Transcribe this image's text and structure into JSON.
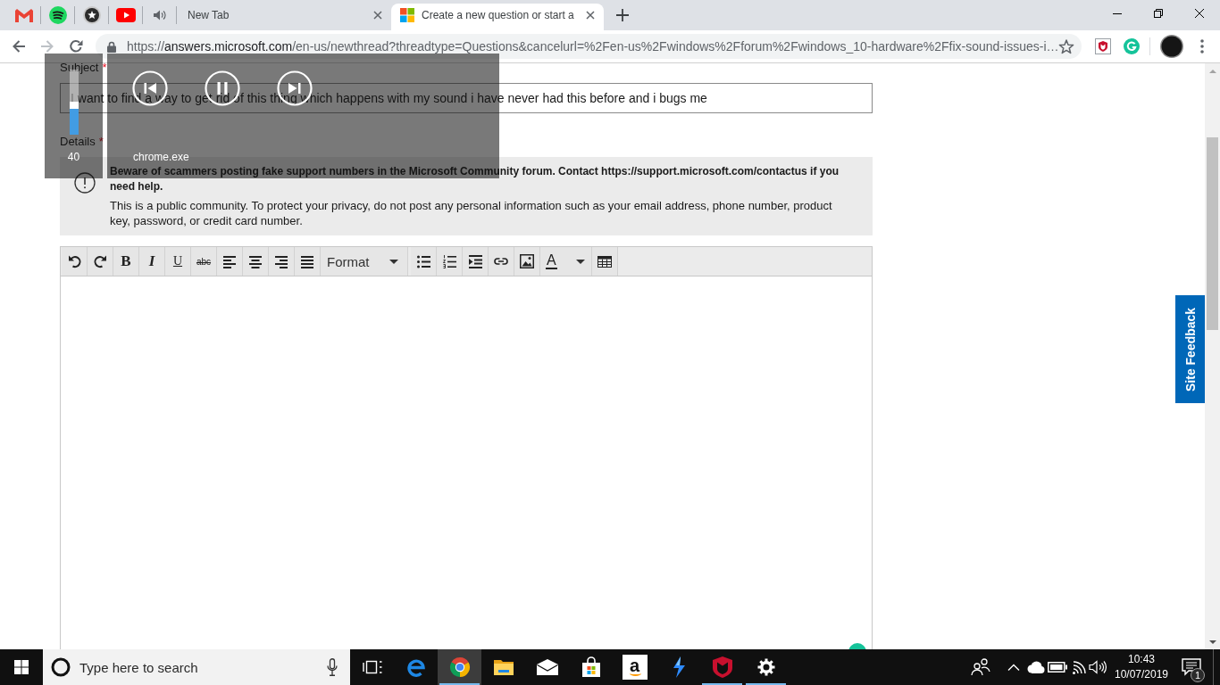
{
  "tab_strip": {
    "pinned_tabs": [
      {
        "kind": "letter-m"
      },
      {
        "kind": "waves"
      },
      {
        "kind": "star"
      },
      {
        "kind": "play"
      },
      {
        "kind": "speaker"
      }
    ],
    "tabs": [
      {
        "kind": "plain",
        "title": "New Tab",
        "selected": false
      },
      {
        "kind": "tiles",
        "title": "Create a new question or start a",
        "selected": true
      }
    ]
  },
  "toolbar": {
    "back": {
      "disabled": false
    },
    "forward": {
      "disabled": true
    },
    "address": {
      "scheme": "https://",
      "host": "answers.microsoft.com",
      "path": "/en-us/newthread?threadtype=Questions&cancelurl=%2Fen-us%2Fwindows%2Fforum%2Fwindows_10-hardware%2Ffix-sound-issues-i…"
    }
  },
  "form": {
    "subject": {
      "label": "Subject",
      "required_mark": "*",
      "value": "I want to find a way to get rid of this thing which happens with my sound i have never had this before and i bugs me"
    },
    "details": {
      "label": "Details",
      "required_mark": "*"
    },
    "notice": {
      "warning": "Beware of scammers posting fake support numbers in the Microsoft Community forum. Contact https://support.microsoft.com/contactus if you need help.",
      "text": "This is a public community. To protect your privacy, do not post any personal information such as your email address, phone number, product key, password, or credit card number."
    },
    "editor": {
      "tools": [
        {
          "kind": "undo"
        },
        {
          "kind": "redo"
        },
        {
          "kind": "bold",
          "label": "B"
        },
        {
          "kind": "italic",
          "label": "I"
        },
        {
          "kind": "underline",
          "label": "U"
        },
        {
          "kind": "strike",
          "label": "abc"
        },
        {
          "kind": "align-left"
        },
        {
          "kind": "align-center"
        },
        {
          "kind": "align-right"
        },
        {
          "kind": "justify"
        },
        {
          "kind": "select",
          "label": "Format"
        },
        {
          "kind": "bullets"
        },
        {
          "kind": "numbers"
        },
        {
          "kind": "indent"
        },
        {
          "kind": "link"
        },
        {
          "kind": "image"
        },
        {
          "kind": "color",
          "label": "A"
        },
        {
          "kind": "table"
        }
      ]
    }
  },
  "site_feedback": {
    "label": "Site Feedback"
  },
  "volume_overlay": {
    "level": 0.4,
    "reading": "40",
    "app": "chrome.exe",
    "playing": true
  },
  "taskbar": {
    "search": {
      "placeholder": "Type here to search"
    },
    "apps": [
      {
        "kind": "taskview",
        "running": false,
        "selected": false
      },
      {
        "kind": "letter-e",
        "running": false,
        "selected": false
      },
      {
        "kind": "wheel",
        "running": true,
        "selected": true
      },
      {
        "kind": "folder",
        "running": false,
        "selected": false
      },
      {
        "kind": "envelope",
        "running": false,
        "selected": false
      },
      {
        "kind": "bag",
        "running": false,
        "selected": false
      },
      {
        "kind": "letter-tile",
        "label": "a",
        "running": false,
        "selected": false
      },
      {
        "kind": "bolt",
        "running": false,
        "selected": false
      },
      {
        "kind": "shield",
        "running": true,
        "selected": false
      },
      {
        "kind": "gear",
        "running": true,
        "selected": false
      }
    ],
    "clock": {
      "time": "10:43",
      "date": "10/07/2019"
    },
    "notifications": {
      "count": "1"
    }
  }
}
